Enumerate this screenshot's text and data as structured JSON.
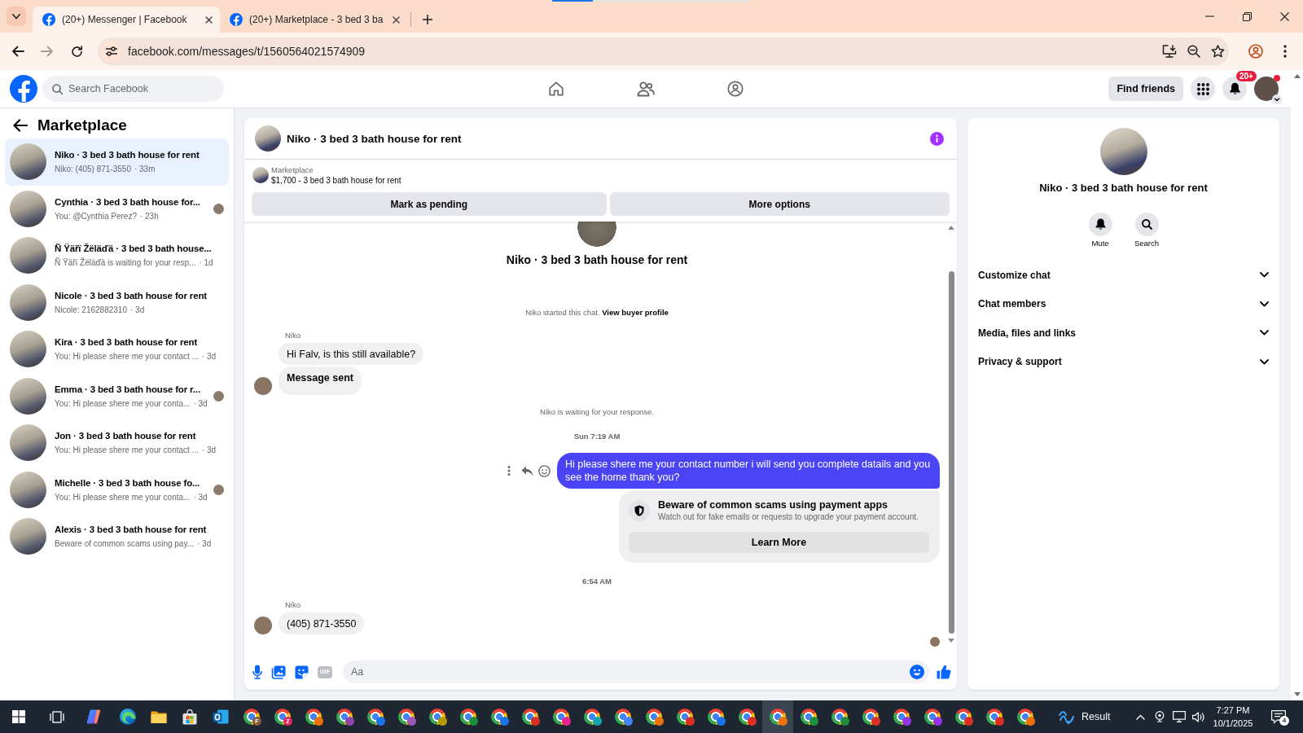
{
  "browser": {
    "tabs": [
      {
        "title": "(20+) Messenger | Facebook",
        "selected": true
      },
      {
        "title": "(20+) Marketplace - 3 bed 3 ba",
        "selected": false
      }
    ],
    "can_go_forward": false,
    "url": "facebook.com/messages/t/1560564021574909"
  },
  "header": {
    "search": {
      "placeholder": "Search Facebook"
    },
    "find_friends": "Find friends",
    "notification_count": "20+",
    "account_dot": true
  },
  "sidebar": {
    "title": "Marketplace",
    "conversations": [
      {
        "title": "Niko · 3 bed 3 bath house for rent",
        "preview": "Niko: (405) 871-3550",
        "time": "· 33m",
        "selected": true,
        "seen": false
      },
      {
        "title": "Cynthia · 3 bed 3 bath house for...",
        "preview": "You: @Cynthia Perez?",
        "time": "· 23h",
        "selected": false,
        "seen": true
      },
      {
        "title": "Ñ Ÿäřï Žëläďä · 3 bed 3 bath house...",
        "preview": "Ñ Ÿäřï Žëläďä is waiting for your resp...",
        "time": "· 1d",
        "selected": false,
        "seen": false
      },
      {
        "title": "Nicole · 3 bed 3 bath house for rent",
        "preview": "Nicole: 2162882310",
        "time": "· 3d",
        "selected": false,
        "seen": false
      },
      {
        "title": "Kira · 3 bed 3 bath house for rent",
        "preview": "You: Hi please shere me your contact ...",
        "time": "· 3d",
        "selected": false,
        "seen": false
      },
      {
        "title": "Emma · 3 bed 3 bath house for r...",
        "preview": "You: Hi please shere me your conta...",
        "time": "· 3d",
        "selected": false,
        "seen": true
      },
      {
        "title": "Jon · 3 bed 3 bath house for rent",
        "preview": "You: Hi please shere me your contact ...",
        "time": "· 3d",
        "selected": false,
        "seen": false
      },
      {
        "title": "Michelle · 3 bed 3 bath house fo...",
        "preview": "You: Hi please shere me your conta...",
        "time": "· 3d",
        "selected": false,
        "seen": true
      },
      {
        "title": "Alexis · 3 bed 3 bath house for rent",
        "preview": "Beware of common scams using pay...",
        "time": "· 3d",
        "selected": false,
        "seen": false
      }
    ]
  },
  "chat": {
    "title": "Niko · 3 bed 3 bath house for rent",
    "listing": {
      "source": "Marketplace",
      "summary": "$1,700 - 3 bed 3 bath house for rent"
    },
    "actions": [
      "Mark as pending",
      "More options"
    ],
    "messages": [
      {
        "kind": "intro",
        "text": "Niko · 3 bed 3 bath house for rent"
      },
      {
        "kind": "notice",
        "text": "Niko started this chat.",
        "link": "View buyer profile"
      },
      {
        "kind": "incoming",
        "sender": "Niko",
        "bubbles": [
          {
            "text": "Hi Falv, is this still available?",
            "bold": false
          },
          {
            "text": "Message sent",
            "bold": true
          }
        ]
      },
      {
        "kind": "notice",
        "text": "Niko is waiting for your response."
      },
      {
        "kind": "timestamp",
        "text": "Sun 7:19 AM"
      },
      {
        "kind": "outgoing",
        "text": "Hi please shere me your contact number i will send you complete datails and you see the home thank you?",
        "hover_actions": true
      },
      {
        "kind": "warning",
        "title": "Beware of common scams using payment apps",
        "text": "Watch out for fake emails or requests to upgrade your payment account.",
        "button": "Learn More"
      },
      {
        "kind": "timestamp",
        "text": "6:54 AM"
      },
      {
        "kind": "incoming",
        "sender": "Niko",
        "bubbles": [
          {
            "text": "(405) 871-3550",
            "bold": false
          }
        ]
      }
    ],
    "read_receipt": true,
    "composer": {
      "placeholder": "Aa",
      "gif_label": "GIF"
    }
  },
  "details": {
    "title": "Niko · 3 bed 3 bath house for rent",
    "actions": [
      {
        "kind": "mute",
        "label": "Mute"
      },
      {
        "kind": "search",
        "label": "Search"
      }
    ],
    "sections": [
      {
        "label": "Customize chat",
        "expanded": false
      },
      {
        "label": "Chat members",
        "expanded": false
      },
      {
        "label": "Media, files and links",
        "expanded": false
      },
      {
        "label": "Privacy & support",
        "expanded": false
      }
    ]
  },
  "taskbar": {
    "windows": [
      {
        "badge": "F",
        "color": "#8b5a3c",
        "selected": false
      },
      {
        "badge": "Z",
        "color": "#e0245e",
        "selected": false
      },
      {
        "color": "#e8710a",
        "selected": false
      },
      {
        "color": "#8e44ad",
        "selected": false
      },
      {
        "color": "#1a73e8",
        "selected": false
      },
      {
        "color": "#9b59b6",
        "selected": false
      },
      {
        "color": "#b59a00",
        "selected": false
      },
      {
        "color": "#1e8e3e",
        "selected": false
      },
      {
        "color": "#1a73e8",
        "selected": false
      },
      {
        "color": "#d93025",
        "selected": false
      },
      {
        "color": "#e52592",
        "selected": false
      },
      {
        "color": "#12a4af",
        "selected": false
      },
      {
        "color": "#4285f4",
        "selected": false
      },
      {
        "color": "#e8710a",
        "selected": false
      },
      {
        "color": "#d93025",
        "selected": false
      },
      {
        "color": "#1a73e8",
        "selected": false
      },
      {
        "color": "#d93025",
        "selected": false
      },
      {
        "color": "#e8710a",
        "selected": true
      },
      {
        "color": "#1e8e3e",
        "selected": false
      },
      {
        "color": "#1e8e3e",
        "selected": false
      },
      {
        "color": "#d93025",
        "selected": false
      },
      {
        "color": "#9334e6",
        "selected": false
      },
      {
        "color": "#9334e6",
        "selected": false
      },
      {
        "color": "#d93025",
        "selected": false
      },
      {
        "color": "#d93025",
        "selected": false
      },
      {
        "color": "#e8710a",
        "selected": false
      }
    ],
    "widget": "Result",
    "time": "7:27 PM",
    "date": "10/1/2025",
    "notifications": "4"
  }
}
